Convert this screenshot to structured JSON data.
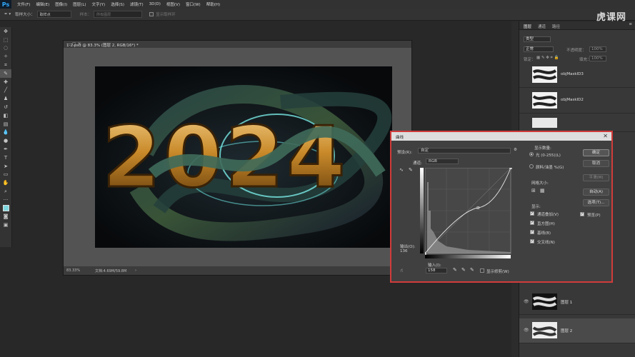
{
  "app": {
    "logo": "Ps"
  },
  "menu": [
    "文件(F)",
    "编辑(E)",
    "图像(I)",
    "图层(L)",
    "文字(Y)",
    "选择(S)",
    "滤镜(T)",
    "3D(D)",
    "视图(V)",
    "窗口(W)",
    "帮助(H)"
  ],
  "options_bar": {
    "sample_size_label": "取样大小：",
    "sample_size_value": "取样点",
    "sample_label": "样本：",
    "sample_value": "所有图层",
    "show_ring_label": "显示取样环"
  },
  "watermark": "虎课网",
  "toolbox": {
    "icons": [
      "move-icon",
      "marquee-icon",
      "lasso-icon",
      "magic-wand-icon",
      "crop-icon",
      "eyedropper-icon",
      "healing-icon",
      "brush-icon",
      "stamp-icon",
      "history-brush-icon",
      "eraser-icon",
      "gradient-icon",
      "blur-icon",
      "dodge-icon",
      "pen-icon",
      "type-icon",
      "path-select-icon",
      "shape-icon",
      "hand-icon",
      "zoom-icon",
      "more-icon",
      "color-swatch-icon",
      "quickmask-icon",
      "screenmode-icon"
    ]
  },
  "document": {
    "tab_title": "1-2.psd @ 83.3% (图层 2, RGB/16*) *",
    "zoom": "83.33%",
    "doc_size": "文档:4.69M/59.8M",
    "artwork_text": "2024"
  },
  "panels": {
    "tabs": [
      "图层",
      "通道",
      "路径"
    ],
    "filter_label": "类型",
    "blend_mode": "正常",
    "opacity_label": "不透明度：",
    "opacity_value": "100%",
    "lock_label": "锁定：",
    "fill_label": "填充：",
    "fill_value": "100%",
    "layers": [
      {
        "name": "objMaskID3"
      },
      {
        "name": "objMaskID2"
      },
      {
        "name": ""
      },
      {
        "name": "图层 1"
      },
      {
        "name": "图层 2"
      }
    ]
  },
  "curves": {
    "title": "曲线",
    "preset_label": "预设(R):",
    "preset_value": "自定",
    "channel_label": "通道:",
    "channel_value": "RGB",
    "output_label": "输出(O):",
    "output_value": "136",
    "input_label": "输入(I):",
    "input_value": "158",
    "show_clipping_label": "显示修剪(W)",
    "show_amount_label": "显示数量:",
    "light_option": "光 (0-255)(L)",
    "pigment_option": "颜料/油墨 %(G)",
    "grid_size_label": "网格大小:",
    "show_label": "显示:",
    "channel_overlays": "通道叠加(V)",
    "histogram": "直方图(H)",
    "baseline": "基线(B)",
    "intersection_line": "交叉线(N)",
    "ok": "确定",
    "cancel": "取消",
    "smooth": "平滑(M)",
    "auto": "自动(A)",
    "options": "选项(T)...",
    "preview": "预览(P)",
    "curve_points": [
      [
        0,
        0
      ],
      [
        158,
        136
      ],
      [
        255,
        255
      ]
    ]
  }
}
